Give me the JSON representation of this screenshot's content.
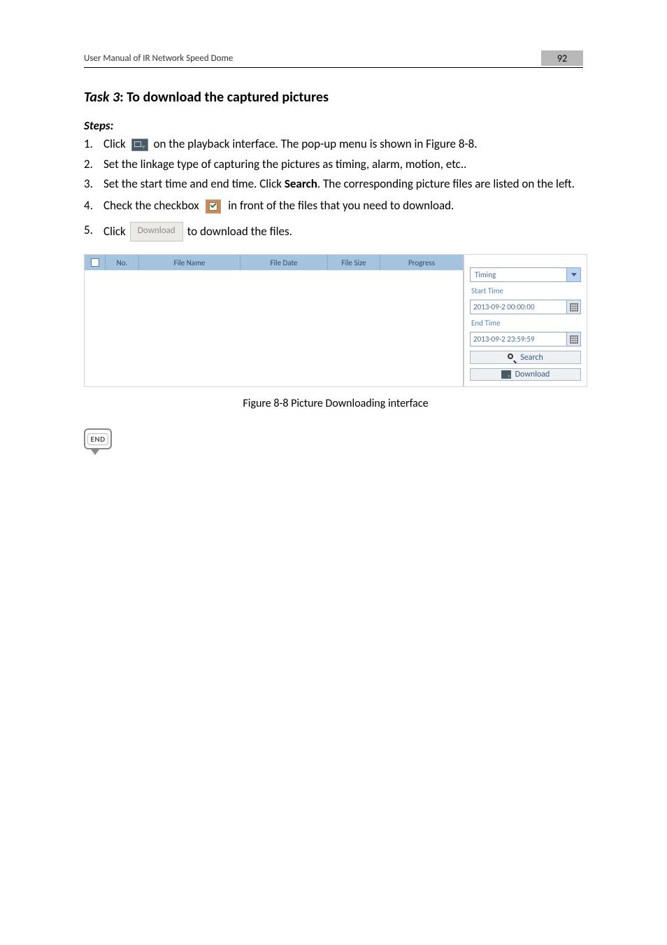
{
  "header": {
    "title": "User Manual of IR Network Speed Dome",
    "page_number": "92"
  },
  "task": {
    "label": "Task 3",
    "title": ": To download the captured pictures"
  },
  "steps_label": "Steps:",
  "steps": [
    {
      "num": "1.",
      "pre": "Click ",
      "post_a": " on the playback interface. The pop-up menu is shown in Figure 8-8."
    },
    {
      "num": "2.",
      "text": "Set the linkage type of capturing the pictures as timing, alarm, motion, etc.."
    },
    {
      "num": "3.",
      "text_a": "Set the start time and end time. Click ",
      "bold": "Search",
      "text_b": ". The corresponding picture files are listed on the left."
    },
    {
      "num": "4.",
      "pre": "Check the checkbox ",
      "post": " in front of the files that you need to download."
    },
    {
      "num": "5.",
      "pre": "Click ",
      "btn": "Download",
      "post": " to download the files."
    }
  ],
  "table": {
    "headers": {
      "no": "No.",
      "name": "File Name",
      "date": "File Date",
      "size": "File Size",
      "progress": "Progress"
    }
  },
  "panel": {
    "type_value": "Timing",
    "start_label": "Start Time",
    "start_value": "2013-09-2 00:00:00",
    "end_label": "End Time",
    "end_value": "2013-09-2 23:59:59",
    "search_btn": "Search",
    "download_btn": "Download"
  },
  "caption": "Figure 8-8 Picture Downloading interface",
  "end_label": "END"
}
